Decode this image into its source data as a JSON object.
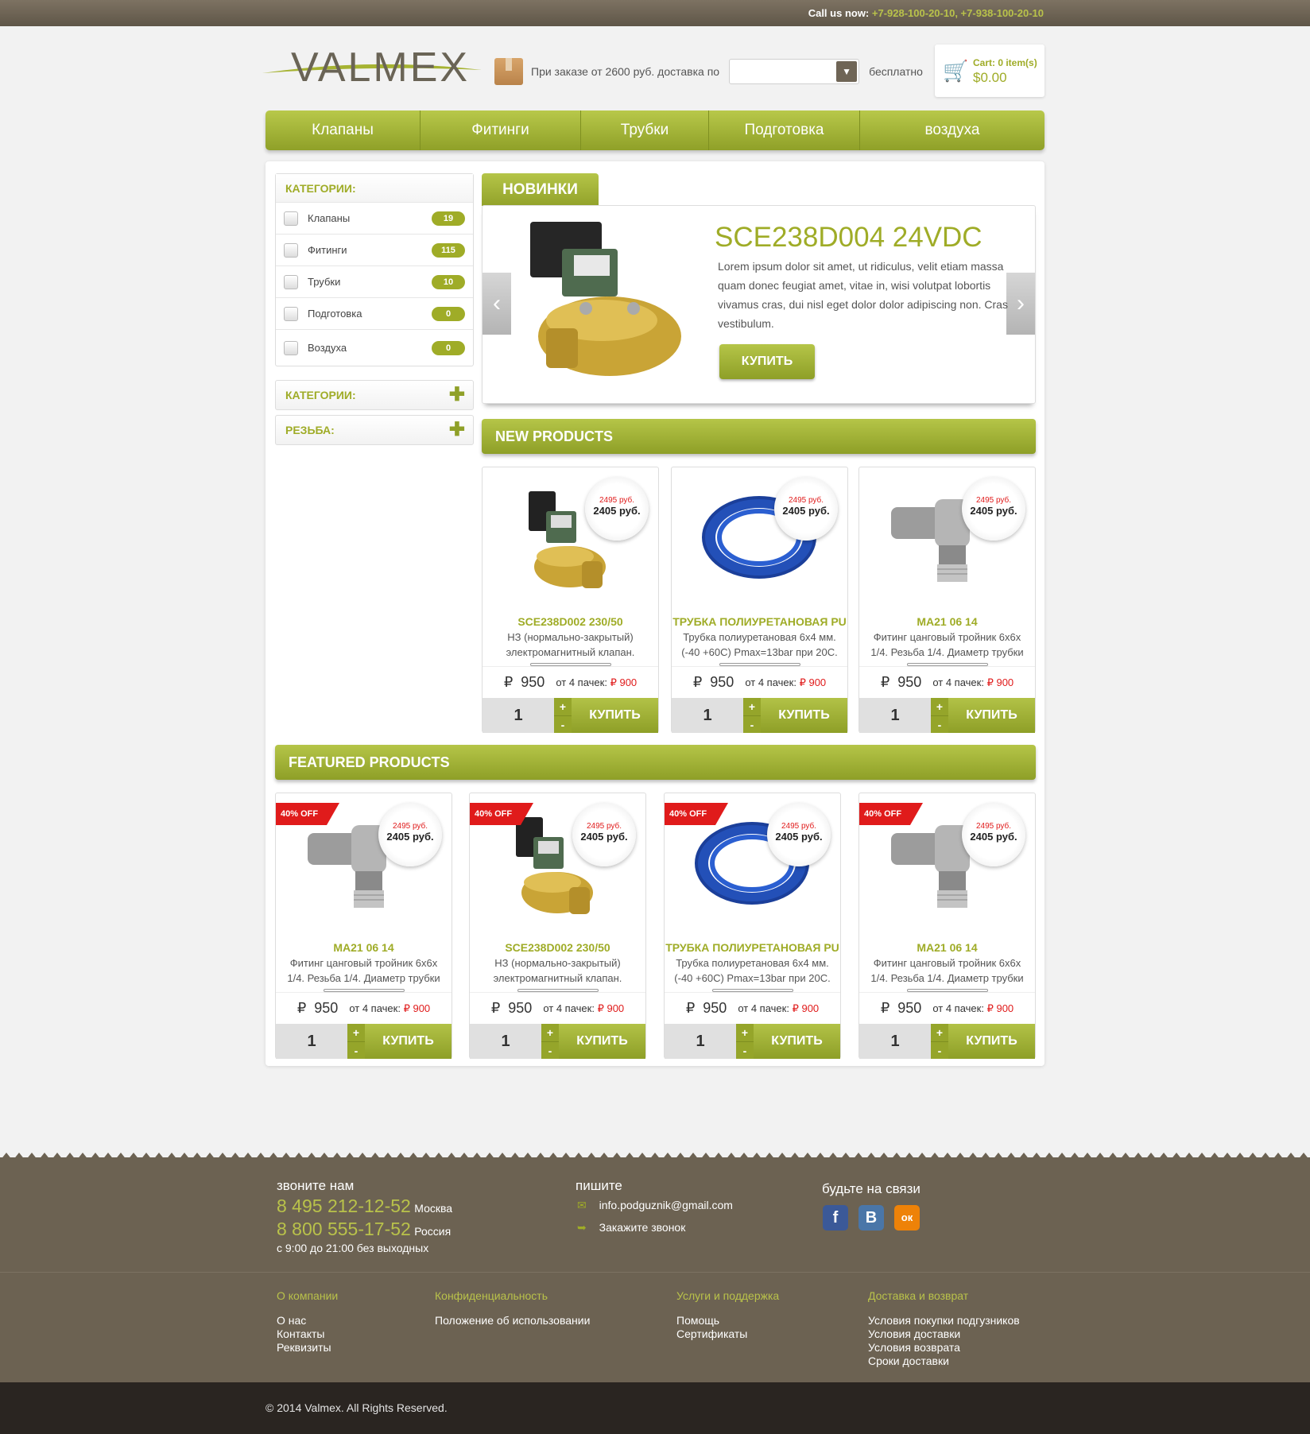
{
  "topbar": {
    "call_label": "Call us now:",
    "phones": "+7-928-100-20-10, +7-938-100-20-10"
  },
  "logo": {
    "text": "VALMEX"
  },
  "promo": {
    "text_before": "При заказе от 2600 руб. доставка по",
    "select_value": "",
    "text_after": "бесплатно"
  },
  "cart": {
    "items": "Cart: 0 item(s)",
    "total": "$0.00"
  },
  "nav": [
    "Клапаны",
    "Фитинги",
    "Трубки",
    "Подготовка",
    "воздуха"
  ],
  "sidebar": {
    "categories_title": "КАТЕГОРИИ:",
    "categories": [
      {
        "label": "Клапаны",
        "count": "19"
      },
      {
        "label": "Фитинги",
        "count": "115"
      },
      {
        "label": "Трубки",
        "count": "10"
      },
      {
        "label": "Подготовка",
        "count": "0"
      },
      {
        "label": "Воздуха",
        "count": "0"
      }
    ],
    "collapsed": [
      "КАТЕГОРИИ:",
      "РЕЗЬБА:"
    ]
  },
  "slider": {
    "tab": "НОВИНКИ",
    "title": "SCE238D004 24VDC",
    "description": "Lorem ipsum dolor sit amet, ut ridiculus, velit etiam massa quam donec feugiat amet, vitae in, wisi volutpat lobortis vivamus cras, dui nisl eget dolor dolor adipiscing non. Cras vestibulum.",
    "buy_label": "КУПИТЬ"
  },
  "new_products": {
    "title": "NEW PRODUCTS",
    "items": [
      {
        "type": "valve",
        "old_price": "2495 руб.",
        "new_price": "2405  руб.",
        "name": "SCE238D002 230/50",
        "desc": "НЗ (нормально-закрытый) электромагнитный клапан.",
        "price": "950",
        "bulk_label": "от 4 пачек:",
        "bulk_price": "₽ 900",
        "qty": "1",
        "buy": "КУПИТЬ"
      },
      {
        "type": "tube",
        "old_price": "2495 руб.",
        "new_price": "2405  руб.",
        "name": "ТРУБКА ПОЛИУРЕТАНОВАЯ PU",
        "desc": "Трубка полиуретановая 6х4 мм. (-40 +60С) Pmax=13bar при 20С.",
        "price": "950",
        "bulk_label": "от 4 пачек:",
        "bulk_price": "₽ 900",
        "qty": "1",
        "buy": "КУПИТЬ"
      },
      {
        "type": "fitting",
        "old_price": "2495 руб.",
        "new_price": "2405  руб.",
        "name": "MA21 06 14",
        "desc": "Фитинг цанговый тройник 6х6х 1/4. Резьба 1/4. Диаметр трубки",
        "price": "950",
        "bulk_label": "от 4 пачек:",
        "bulk_price": "₽ 900",
        "qty": "1",
        "buy": "КУПИТЬ"
      }
    ]
  },
  "featured_products": {
    "title": "FEATURED PRODUCTS",
    "items": [
      {
        "type": "fitting",
        "off": "40% OFF",
        "old_price": "2495 руб.",
        "new_price": "2405  руб.",
        "name": "MA21 06 14",
        "desc": "Фитинг цанговый тройник 6х6х 1/4. Резьба 1/4. Диаметр трубки",
        "price": "950",
        "bulk_label": "от 4 пачек:",
        "bulk_price": "₽ 900",
        "qty": "1",
        "buy": "КУПИТЬ"
      },
      {
        "type": "valve",
        "off": "40% OFF",
        "old_price": "2495 руб.",
        "new_price": "2405  руб.",
        "name": "SCE238D002 230/50",
        "desc": "НЗ (нормально-закрытый) электромагнитный клапан.",
        "price": "950",
        "bulk_label": "от 4 пачек:",
        "bulk_price": "₽ 900",
        "qty": "1",
        "buy": "КУПИТЬ"
      },
      {
        "type": "tube",
        "off": "40% OFF",
        "old_price": "2495 руб.",
        "new_price": "2405  руб.",
        "name": "ТРУБКА ПОЛИУРЕТАНОВАЯ PU",
        "desc": "Трубка полиуретановая 6х4 мм. (-40 +60С) Pmax=13bar при 20С.",
        "price": "950",
        "bulk_label": "от 4 пачек:",
        "bulk_price": "₽ 900",
        "qty": "1",
        "buy": "КУПИТЬ"
      },
      {
        "type": "fitting",
        "off": "40% OFF",
        "old_price": "2495 руб.",
        "new_price": "2405  руб.",
        "name": "MA21 06 14",
        "desc": "Фитинг цанговый тройник 6х6х 1/4. Резьба 1/4. Диаметр трубки",
        "price": "950",
        "bulk_label": "от 4 пачек:",
        "bulk_price": "₽ 900",
        "qty": "1",
        "buy": "КУПИТЬ"
      }
    ]
  },
  "footer": {
    "call_title": "звоните нам",
    "phone1": "8 495 212-12-52",
    "city1": "Москва",
    "phone2": "8 800 555-17-52",
    "city2": "Россия",
    "hours": "с 9:00 до 21:00 без выходных",
    "write_title": "пишите",
    "email": "info.podguznik@gmail.com",
    "callback": "Закажите звонок",
    "social_title": "будьте на связи",
    "social": [
      "f",
      "B",
      "ок"
    ],
    "columns": [
      {
        "title": "О компании",
        "links": [
          "О нас",
          "Контакты",
          "Реквизиты"
        ]
      },
      {
        "title": "Конфиденциальность",
        "links": [
          "Положение об использовании"
        ]
      },
      {
        "title": "Услуги и поддержка",
        "links": [
          "Помощь",
          "Сертификаты"
        ]
      },
      {
        "title": "Доставка и возврат",
        "links": [
          "Условия покупки подгузников",
          "Условия доставки",
          "Условия возврата",
          "Сроки доставки"
        ]
      }
    ],
    "copyright": "© 2014 Valmex. All Rights Reserved."
  },
  "colors": {
    "accent": "#9fac27",
    "footer": "#6c6252",
    "price_red": "#e01b1b"
  }
}
